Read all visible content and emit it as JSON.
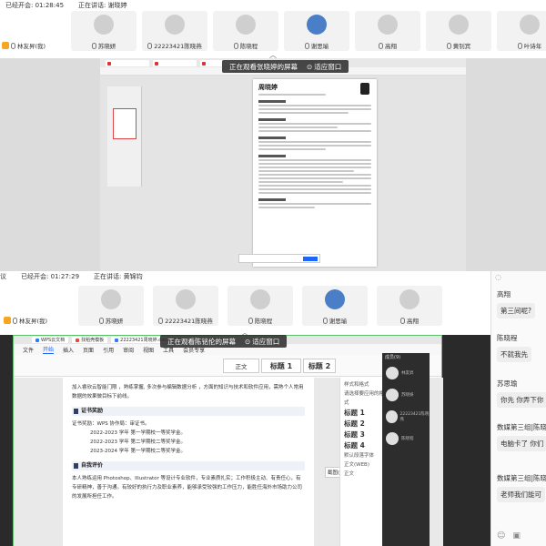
{
  "top": {
    "status_opened": "已经开会: 01:28:45",
    "status_speaking": "正在讲话: 谢晓婷",
    "host_name": "林友昇(我)",
    "participants": [
      {
        "name": "苏晓妍"
      },
      {
        "name": "22223421陈晓燕"
      },
      {
        "name": "陈晓程"
      },
      {
        "name": "谢思瑜"
      },
      {
        "name": "高翔"
      },
      {
        "name": "黄钊宾"
      },
      {
        "name": "叶诗年"
      }
    ],
    "banner_text": "正在观看张晓婷的屏幕",
    "banner_button": "适应窗口",
    "resume_name": "周晓婷"
  },
  "bottom": {
    "left_label": "议",
    "status_opened": "已经开会: 01:27:29",
    "status_speaking": "正在讲话: 黄锦钧",
    "host_name": "林友昇(我)",
    "participants": [
      {
        "name": "苏晓妍"
      },
      {
        "name": "22223421陈晓燕"
      },
      {
        "name": "陈晓程"
      },
      {
        "name": "谢思瑜"
      },
      {
        "name": "高翔"
      }
    ],
    "banner_text": "正在观看陈铭伦的屏幕",
    "banner_button": "适应窗口",
    "editor_tabs": [
      "WPS云文档",
      "找稻壳模板",
      "22223421周晓婷.docx"
    ],
    "editor_menu": [
      "文件",
      "开始",
      "插入",
      "页面",
      "引用",
      "审阅",
      "视图",
      "工具",
      "会员专享"
    ],
    "styles": [
      "正文",
      "标题 1",
      "标题 2"
    ],
    "doc": {
      "intro": "加入睿欣云智能门限 ，熟练掌握, 多次参与编辑数据分析 ，方面的知识与技术和软件应用，需熟个人常用数据的效果做目标下前线。",
      "section1": "证书奖励",
      "cert_intro": "证书奖励：WPS 协作局：审证书。",
      "cert_rows": [
        "2022-2023 学年 第一学期校一等奖学金。",
        "2022-2023 学年 第二学期校二等奖学金。",
        "2023-2024 学年 第一学期校二等奖学金。"
      ],
      "section2": "自我评价",
      "eval": "本人熟练运用 Photoshop、Illustrator 等设计专业软件，专业素质扎实；工作积极主动、有责任心，有专研精神，善于沟通。有较好的执行力及职业素养，能够承受较强的工作压力，能胜任海外市场助力公司的发展所担任工作。"
    },
    "style_pane": {
      "title": "样式和格式",
      "apply_label": "请选择要应用的格式",
      "items": [
        "标题 1",
        "标题 2",
        "标题 3",
        "标题 4"
      ],
      "default_font": "默认段落字体",
      "normal": "正文(WEB)",
      "plain": "正文"
    },
    "member_panel_title": "成员(9)",
    "members": [
      "林友昇",
      "苏晓妍",
      "22223421陈晓燕",
      "陈晓程"
    ],
    "screenshot_label": "截图(Alt + A)",
    "chat": [
      {
        "sender": "高翔",
        "text": "第三间呢?"
      },
      {
        "sender": "陈晓程",
        "text": "不就我先"
      },
      {
        "sender": "苏思瑜",
        "text": "你先 你弄下你"
      },
      {
        "sender": "数媒第三组|陈晓",
        "text": "电脑卡了 你们"
      },
      {
        "sender": "数媒第三组|陈晓",
        "text": "老师我们能可"
      }
    ]
  },
  "colors": {
    "accent": "#1a66ff",
    "host_badge": "#f5a623",
    "banner_bg": "#282828",
    "member_panel_bg": "#2d2d2d",
    "section_block": "#2c3e6b"
  }
}
